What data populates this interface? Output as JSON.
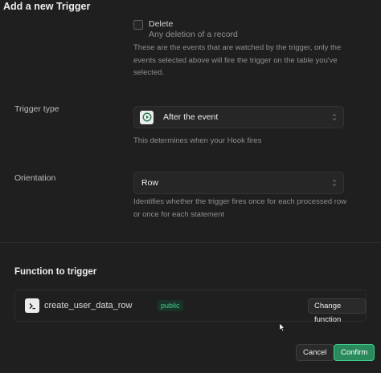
{
  "dialog": {
    "title": "Add a new Trigger"
  },
  "events": {
    "delete_option": {
      "label": "Delete",
      "description": "Any deletion of a record",
      "checked": false
    },
    "help_lines": [
      "These are the events that are watched by the trigger, only the",
      "events selected above will fire the trigger on the table you've",
      "selected."
    ]
  },
  "trigger_type": {
    "label": "Trigger type",
    "value": "After the event",
    "icon": "play-circle-icon",
    "help": "This determines when your Hook fires"
  },
  "orientation": {
    "label": "Orientation",
    "value": "Row",
    "help_lines": [
      "Identifies whether the trigger fires once for each processed row",
      "or once for each statement"
    ]
  },
  "function_section": {
    "title": "Function to trigger",
    "function_name": "create_user_data_row",
    "badge": "public",
    "icon": "terminal-icon",
    "change_label": "Change function"
  },
  "footer": {
    "cancel_label": "Cancel",
    "confirm_label": "Confirm"
  },
  "colors": {
    "background": "#1f1f1f",
    "accent_green": "#3ecf8e",
    "confirm_bg": "#2b8a5c"
  }
}
